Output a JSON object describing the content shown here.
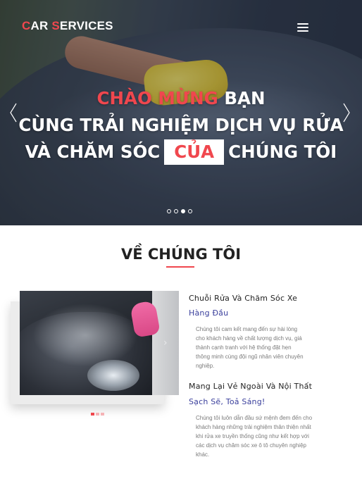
{
  "brand": {
    "first_letter": "C",
    "first_rest": "AR ",
    "second_letter": "S",
    "second_rest": "ERVICES"
  },
  "hero": {
    "line1_red": "CHÀO MỪNG",
    "line1_white": " BẠN",
    "line2": "CÙNG TRẢI NGHIỆM DỊCH VỤ RỬA",
    "line3_before": "VÀ CHĂM SÓC",
    "line3_boxed": "CỦA",
    "line3_after": "CHÚNG TÔI",
    "slide_count": 4,
    "active_slide": 3
  },
  "about": {
    "title": "VỀ CHÚNG TÔI",
    "features": [
      {
        "title": "Chuỗi Rửa Và Chăm Sóc Xe",
        "subtitle": "Hàng Đầu",
        "body_lines": [
          "Chúng tôi cam kết mang đến sự hài lòng",
          "cho khách hàng về chất lượng dịch vụ, giá",
          "thành cạnh tranh với hệ thống đặt hẹn",
          "thông minh cùng đội ngũ nhân viên chuyên",
          "nghiệp."
        ]
      },
      {
        "title": "Mang Lại Vẻ Ngoài Và Nội Thất",
        "subtitle": "Sạch Sẽ, Toả Sáng!",
        "body_lines": [
          "Chúng tôi luôn dẫn đầu sứ mệnh đem đến cho",
          "khách hàng những trải nghiệm thân thiện nhất",
          "khi rửa xe truyền thống cũng như kết hợp với",
          "các dịch vụ chăm sóc xe ô tô chuyên nghiệp",
          "khác."
        ]
      }
    ],
    "gallery_count": 3,
    "gallery_active": 1
  },
  "colors": {
    "accent": "#f0474e",
    "subtitle": "#3a3f9c",
    "body_text": "#7a7a7a"
  },
  "icons": {
    "menu": "hamburger-icon",
    "prev": "chevron-left-icon",
    "next": "chevron-right-icon"
  }
}
